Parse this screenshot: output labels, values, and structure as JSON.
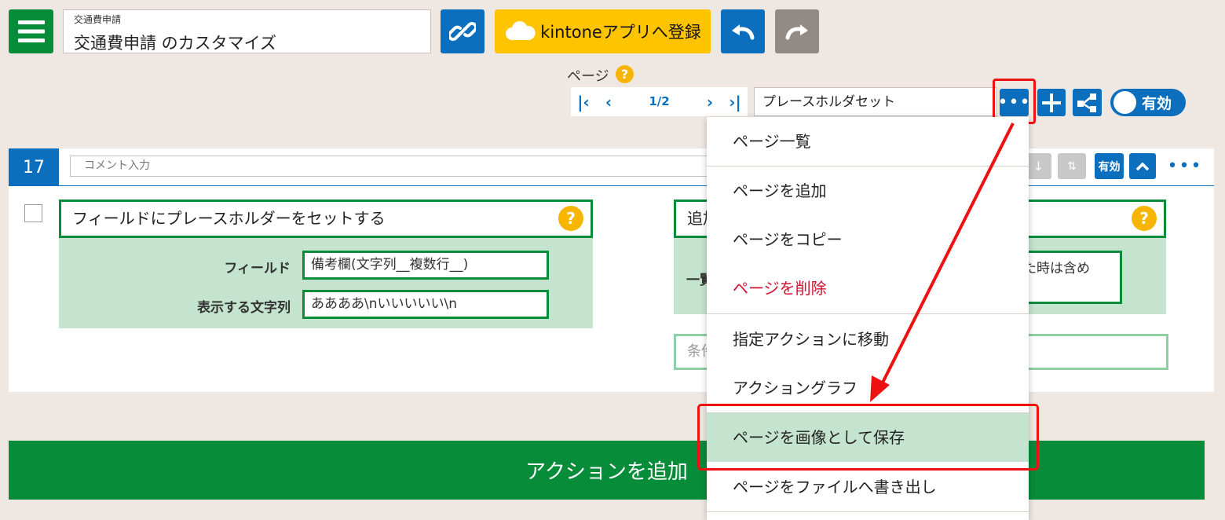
{
  "header": {
    "app_small_title": "交通費申請",
    "app_title": "交通費申請 のカスタマイズ",
    "kintone_button": "kintoneアプリへ登録"
  },
  "page_nav": {
    "label": "ページ",
    "help": "?",
    "page_number": "1/2",
    "selected_page": "プレースホルダセット",
    "toggle_label": "有効"
  },
  "action_card": {
    "number": "17",
    "comment_placeholder": "コメント入力",
    "enabled_badge": "有効",
    "left_panel": {
      "title": "フィールドにプレースホルダーをセットする",
      "field_label": "フィールド",
      "field_value": "備考欄(文字列__複数行__)",
      "text_label": "表示する文字列",
      "text_value": "ああああ\\nいいいいい\\n"
    },
    "right_panel": {
      "title_fragment": "追加",
      "label_fragment": "一覧",
      "value_fragment": "た時は含め",
      "condition_fragment": "条件"
    }
  },
  "add_action_button": "アクションを追加",
  "dropdown_menu": {
    "items": [
      "ページ一覧",
      "ページを追加",
      "ページをコピー",
      "ページを削除",
      "指定アクションに移動",
      "アクショングラフ",
      "ページを画像として保存",
      "ページをファイルへ書き出し"
    ],
    "highlighted_item": "ページを画像として保存",
    "danger_item": "ページを削除"
  },
  "colors": {
    "primary_blue": "#0b6fbe",
    "green": "#078c3a",
    "light_green": "#c4e4cf",
    "yellow": "#ffc400",
    "annotation_red": "#ee1111",
    "danger_red": "#d0102f"
  }
}
